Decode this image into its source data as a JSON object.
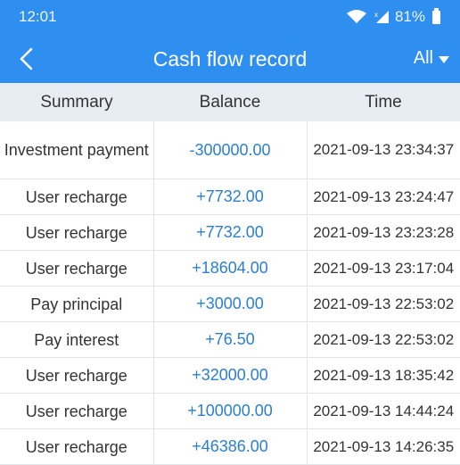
{
  "status_bar": {
    "time": "12:01",
    "battery": "81%"
  },
  "header": {
    "title": "Cash flow record",
    "filter_label": "All"
  },
  "table": {
    "columns": [
      "Summary",
      "Balance",
      "Time"
    ],
    "rows": [
      {
        "summary": "Investment payment",
        "balance": "-300000.00",
        "time": "2021-09-13 23:34:37"
      },
      {
        "summary": "User recharge",
        "balance": "+7732.00",
        "time": "2021-09-13 23:24:47"
      },
      {
        "summary": "User recharge",
        "balance": "+7732.00",
        "time": "2021-09-13 23:23:28"
      },
      {
        "summary": "User recharge",
        "balance": "+18604.00",
        "time": "2021-09-13 23:17:04"
      },
      {
        "summary": "Pay principal",
        "balance": "+3000.00",
        "time": "2021-09-13 22:53:02"
      },
      {
        "summary": "Pay interest",
        "balance": "+76.50",
        "time": "2021-09-13 22:53:02"
      },
      {
        "summary": "User recharge",
        "balance": "+32000.00",
        "time": "2021-09-13 18:35:42"
      },
      {
        "summary": "User recharge",
        "balance": "+100000.00",
        "time": "2021-09-13 14:44:24"
      },
      {
        "summary": "User recharge",
        "balance": "+46386.00",
        "time": "2021-09-13 14:26:35"
      }
    ]
  },
  "colors": {
    "primary": "#2f8ff0",
    "balance_text": "#2b7fd2",
    "header_row_bg": "#e8edf4"
  },
  "icons": {
    "back": "chevron-left-icon",
    "filter": "caret-down-icon",
    "wifi": "wifi-icon",
    "signal": "cell-signal-icon",
    "battery": "battery-icon"
  }
}
